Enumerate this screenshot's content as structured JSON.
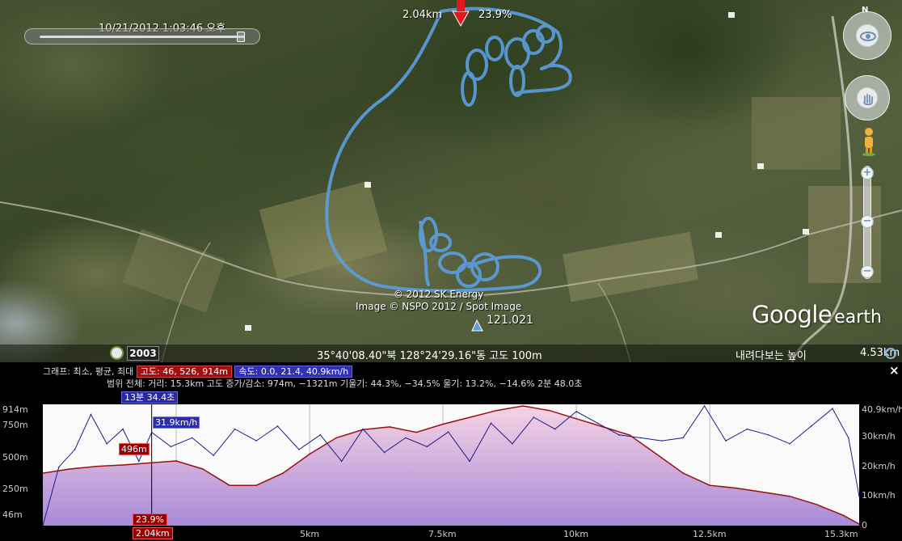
{
  "map": {
    "time": "10/21/2012   1:03:46 오후",
    "marker": {
      "distance": "2.04km",
      "percent": "23.9%"
    },
    "copyright": [
      "© 2012 SK Energy",
      "Image © NSPO 2012 / Spot Image"
    ],
    "elevation_marker": "121.021",
    "logo": {
      "google": "Google",
      "earth": "earth"
    },
    "north_label": "N",
    "zoom_plus": "+",
    "zoom_minus": "−",
    "track_color": "#5b9fe0"
  },
  "statusbar": {
    "year": "2003",
    "coordinates": "35°40'08.40\"북 128°24'29.16\"동 고도  100m",
    "eye_alt_label": "내려다보는 높이",
    "eye_alt_value": "4.53km"
  },
  "profile": {
    "legend_prefix": "그래프: 최소, 평균, 최대",
    "elev_tag": "고도: 46, 526, 914m",
    "speed_tag": "속도: 0.0, 21.4, 40.9km/h",
    "range_line": "범위 전체: 거리: 15.3km 고도 증가/감소: 974m, −1321m 기울기: 44.3%, −34.5% 울기: 13.2%, −14.6% 2분 48.0초",
    "close": "×",
    "time_tag": "13분 34.4초",
    "y_left_labels": [
      "914m",
      "750m",
      "500m",
      "250m",
      "46m"
    ],
    "y_right_labels": [
      "40.9km/h",
      "30km/h",
      "20km/h",
      "10km/h",
      "0"
    ],
    "x_labels": [
      "5km",
      "7.5km",
      "10km",
      "12.5km",
      "15.3km"
    ],
    "cursor": {
      "elevation": "496m",
      "speed": "31.9km/h",
      "percent": "23.9%",
      "distance": "2.04km"
    },
    "colors": {
      "elevation": "#9a1010",
      "speed": "#1a1a8a",
      "fill_top": "#f4d0e0",
      "fill_bottom": "#a88ad8"
    }
  },
  "chart_data": {
    "type": "area",
    "title": "",
    "xlabel": "",
    "ylabel": "",
    "xlim": [
      0,
      15.3
    ],
    "ylim_left": [
      46,
      914
    ],
    "ylim_right": [
      0,
      40.9
    ],
    "series": [
      {
        "name": "고도",
        "unit": "m",
        "x": [
          0,
          0.5,
          1,
          1.5,
          2.04,
          2.5,
          3,
          3.5,
          4,
          4.5,
          5,
          5.5,
          6,
          6.5,
          7,
          7.5,
          8,
          8.5,
          9,
          9.5,
          10,
          10.5,
          11,
          11.5,
          12,
          12.5,
          13,
          13.5,
          14,
          14.5,
          15,
          15.3
        ],
        "values": [
          420,
          450,
          470,
          480,
          496,
          510,
          450,
          330,
          330,
          420,
          560,
          680,
          740,
          760,
          720,
          780,
          830,
          880,
          914,
          880,
          820,
          760,
          700,
          560,
          420,
          330,
          310,
          280,
          250,
          190,
          110,
          46
        ]
      },
      {
        "name": "속도",
        "unit": "km/h",
        "x": [
          0,
          0.3,
          0.6,
          0.9,
          1.2,
          1.5,
          1.8,
          2.04,
          2.4,
          2.8,
          3.2,
          3.6,
          4.0,
          4.4,
          4.8,
          5.2,
          5.6,
          6.0,
          6.4,
          6.8,
          7.2,
          7.6,
          8.0,
          8.4,
          8.8,
          9.2,
          9.6,
          10.0,
          10.4,
          10.8,
          11.2,
          11.6,
          12.0,
          12.4,
          12.8,
          13.2,
          13.6,
          14.0,
          14.4,
          14.8,
          15.1,
          15.3
        ],
        "values": [
          0,
          20,
          26,
          38,
          28,
          33,
          22,
          31.9,
          27,
          30,
          24,
          33,
          29,
          34,
          26,
          31,
          22,
          33,
          25,
          30,
          27,
          32,
          22,
          35,
          28,
          37,
          33,
          39,
          35,
          31,
          30,
          29,
          30,
          40.9,
          29,
          33,
          31,
          28,
          34,
          40,
          30,
          10
        ]
      }
    ]
  }
}
